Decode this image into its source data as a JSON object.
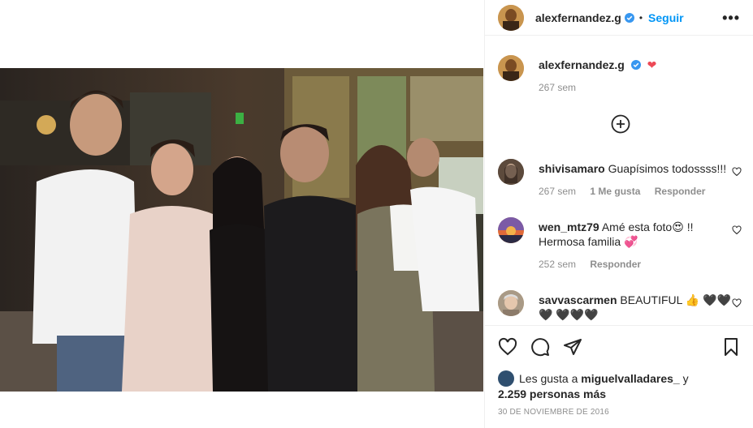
{
  "post_header": {
    "username": "alexfernandez.g",
    "separator": "•",
    "follow_label": "Seguir",
    "more_label": "•••"
  },
  "caption": {
    "username": "alexfernandez.g",
    "emoji": "❤",
    "time": "267 sem"
  },
  "comments": [
    {
      "username": "shivisamaro",
      "text": "Guapísimos todossss!!!",
      "time": "267 sem",
      "likes": "1 Me gusta",
      "reply": "Responder"
    },
    {
      "username": "wen_mtz79",
      "text": "Amé esta foto😍 !! Hermosa familia 💞",
      "time": "252 sem",
      "reply": "Responder"
    },
    {
      "username": "savvascarmen",
      "text": "BEAUTIFUL 👍 🖤🖤🖤 🖤🖤🖤"
    }
  ],
  "likes": {
    "prefix": "Les gusta a",
    "user": "miguelvalladares_",
    "conj": "y",
    "count": "2.259 personas más"
  },
  "date": "30 DE NOVIEMBRE DE 2016",
  "colors": {
    "accent": "#0095f6",
    "heart": "#ed4956",
    "muted": "#8e8e8e",
    "text": "#262626"
  },
  "icons": [
    "verified-icon",
    "heart-icon",
    "comment-icon",
    "share-icon",
    "bookmark-icon",
    "add-circle-icon",
    "more-icon"
  ]
}
